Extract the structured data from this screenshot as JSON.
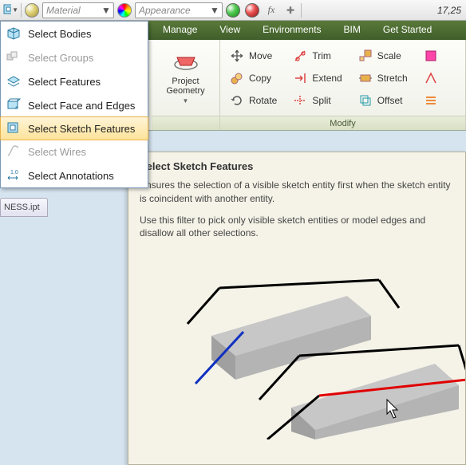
{
  "topbar": {
    "material_combo": "Material",
    "appearance_combo": "Appearance",
    "fx_label": "fx",
    "time": "17,25"
  },
  "tabs": {
    "manage": "Manage",
    "view": "View",
    "environments": "Environments",
    "bim": "BIM",
    "get_started": "Get Started"
  },
  "ribbon": {
    "project_geometry": "Project\nGeometry",
    "move": "Move",
    "copy": "Copy",
    "rotate": "Rotate",
    "trim": "Trim",
    "extend": "Extend",
    "split": "Split",
    "scale": "Scale",
    "stretch": "Stretch",
    "offset": "Offset",
    "modify_panel": "Modify"
  },
  "select_menu": {
    "bodies": "Select Bodies",
    "groups": "Select Groups",
    "features": "Select Features",
    "face_edges": "Select Face and Edges",
    "sketch_features": "Select Sketch Features",
    "wires": "Select Wires",
    "annotations": "Select Annotations"
  },
  "document_tab": "NESS.ipt",
  "tooltip": {
    "title": "Select Sketch Features",
    "para1": "Ensures the selection of a visible sketch entity first when the sketch entity is coincident with another entity.",
    "para2": "Use this filter to pick only visible sketch entities or model edges and disallow all other selections."
  }
}
